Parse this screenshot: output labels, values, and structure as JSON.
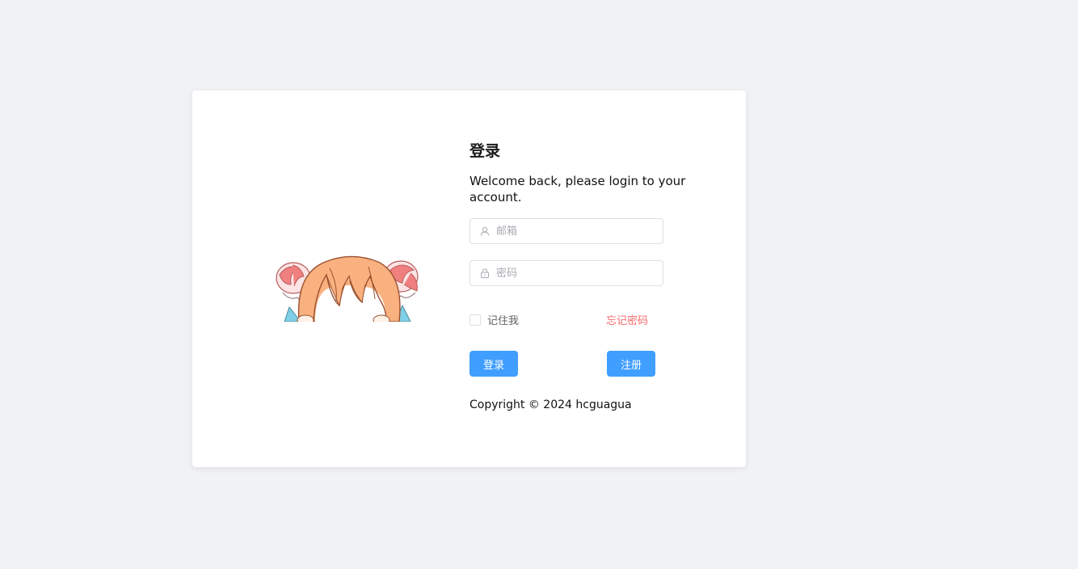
{
  "login_form": {
    "title": "登录",
    "subtitle": "Welcome back, please login to your account.",
    "email": {
      "placeholder": "邮箱",
      "value": "",
      "icon": "user-icon"
    },
    "password": {
      "placeholder": "密码",
      "value": "",
      "icon": "lock-icon"
    },
    "remember_label": "记住我",
    "remember_checked": false,
    "forgot_label": "忘记密码",
    "login_button": "登录",
    "register_button": "注册",
    "copyright": "Copyright © 2024 hcguagua"
  },
  "colors": {
    "background": "#f0f2f5",
    "primary": "#409eff",
    "danger": "#f56c6c"
  }
}
